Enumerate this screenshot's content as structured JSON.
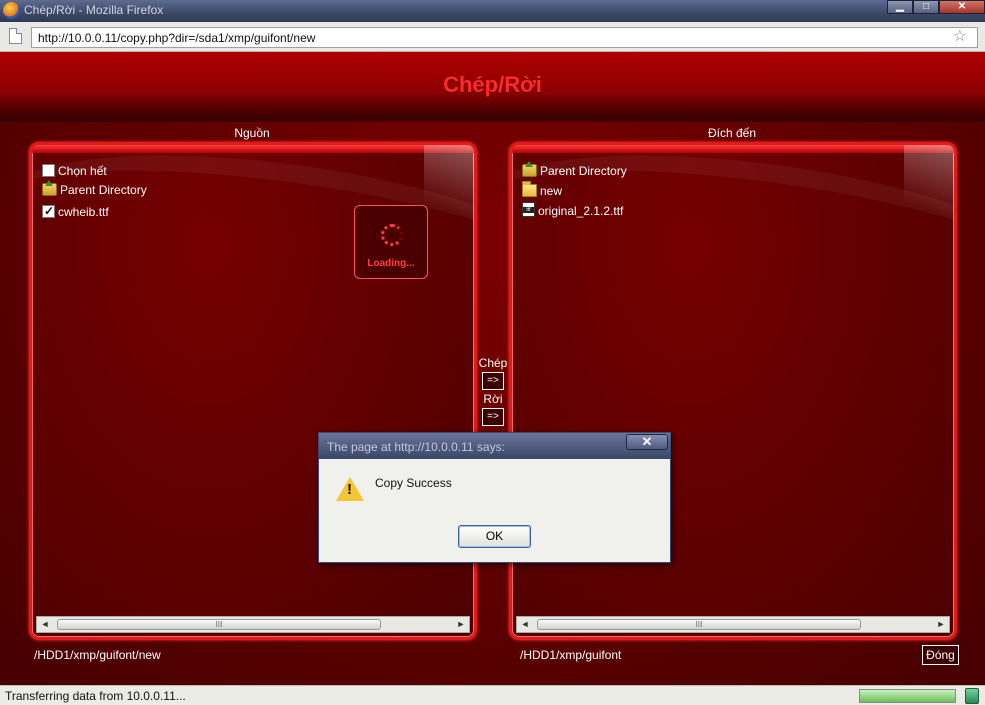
{
  "window": {
    "title": "Chép/Rời - Mozilla Firefox",
    "min_label": "▁",
    "max_label": "□",
    "close_label": "✕"
  },
  "address_bar": {
    "url": "http://10.0.0.11/copy.php?dir=/sda1/xmp/guifont/new"
  },
  "page": {
    "title": "Chép/Rời",
    "source_label": "Nguồn",
    "dest_label": "Đích đến",
    "copy_label": "Chép",
    "copy_button": "=>",
    "move_label": "Rời",
    "move_button": "=>",
    "close_button": "Đóng",
    "loading_text": "Loading..."
  },
  "source": {
    "select_all": "Chọn hết",
    "parent": "Parent Directory",
    "files": [
      {
        "name": "cwheib.ttf",
        "checked": true
      }
    ],
    "path": "/HDD1/xmp/guifont/new"
  },
  "destination": {
    "parent": "Parent Directory",
    "folders": [
      "new"
    ],
    "files": [
      "original_2.1.2.ttf"
    ],
    "path": "/HDD1/xmp/guifont"
  },
  "scrollbar": {
    "left_arrow": "◄",
    "right_arrow": "►",
    "grip": "III"
  },
  "dialog": {
    "title": "The page at http://10.0.0.11 says:",
    "close_label": "✕",
    "message": "Copy Success",
    "ok_label": "OK"
  },
  "status": {
    "text": "Transferring data from 10.0.0.11...",
    "progress": 1.0
  },
  "colors": {
    "accent": "#ff2a2a",
    "pane_border": "#e11a1a",
    "background": "#5c0000"
  }
}
